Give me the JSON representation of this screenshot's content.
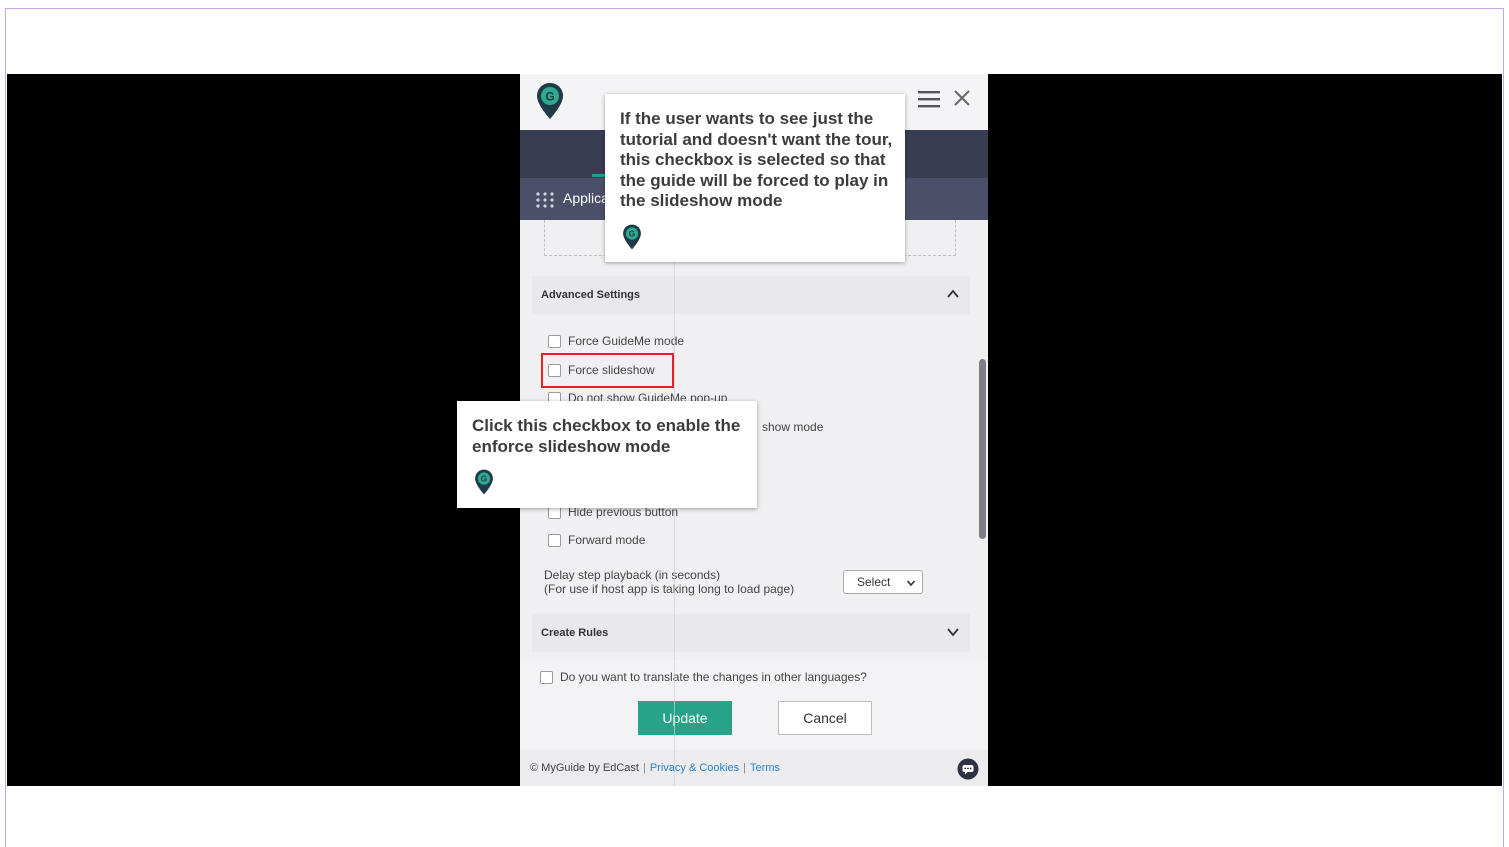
{
  "panel": {
    "app_label": "Applica",
    "sections": {
      "advanced": {
        "title": "Advanced Settings"
      },
      "rules": {
        "title": "Create Rules"
      }
    },
    "options": [
      {
        "label": "Force GuideMe mode"
      },
      {
        "label": "Force slideshow"
      },
      {
        "label": "Do not show GuideMe pop-up"
      },
      {
        "label": "show mode"
      },
      {
        "label": "Hide previous button"
      },
      {
        "label": "Forward mode"
      }
    ],
    "delay": {
      "line1": "Delay step playback (in seconds)",
      "line2": "(For use if host app is taking long to load page)",
      "select_value": "Select"
    },
    "translate_label": "Do you want to translate the changes in other languages?",
    "buttons": {
      "update": "Update",
      "cancel": "Cancel"
    },
    "footer": {
      "copyright": "© MyGuide by EdCast",
      "privacy": "Privacy & Cookies",
      "terms": "Terms",
      "separator": "|"
    }
  },
  "tooltips": {
    "tip1": "If the user wants to see just the tutorial and doesn't want the tour, this checkbox is selected so that the guide will be forced to play in the slideshow mode",
    "tip2": "Click this checkbox to enable the enforce slideshow mode"
  },
  "colors": {
    "accent": "#26a388",
    "nav_dark": "#383d52",
    "highlight": "#e3222a",
    "link": "#2c84c8"
  },
  "icons": [
    "myguide-logo-icon",
    "hamburger-menu-icon",
    "close-icon",
    "app-grid-icon",
    "chevron-up-icon",
    "chevron-down-icon",
    "chat-icon"
  ]
}
